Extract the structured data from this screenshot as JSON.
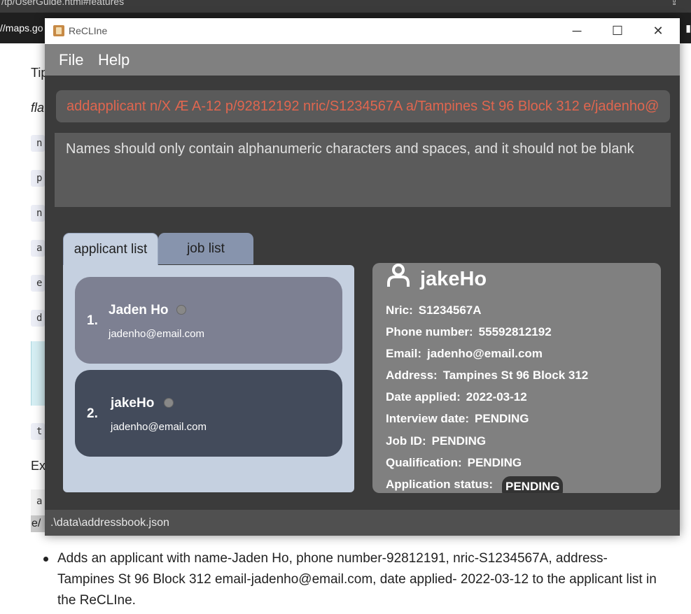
{
  "background": {
    "url_top": "/tp/UserGuide.html#features",
    "url_tab": "//maps.go",
    "lines": [
      "Tip",
      "fla",
      "Ex"
    ],
    "code_letters": [
      "n",
      "p",
      "n",
      "a",
      "e",
      "d",
      "t",
      "a"
    ],
    "selected_fragment": "e/",
    "bullet": "Adds an applicant with name-Jaden Ho, phone number-92812191, nric-S1234567A, address-Tampines St 96 Block 312 email-jadenho@email.com, date applied- 2022-03-12 to the applicant list in the ReCLIne."
  },
  "window": {
    "title": "ReCLIne",
    "menu": [
      "File",
      "Help"
    ],
    "command_text": "addapplicant n/X Æ A-12 p/92812192 nric/S1234567A a/Tampines St 96 Block 312 e/jadenho@",
    "result_text": "Names should only contain alphanumeric characters and spaces, and it should not be blank",
    "tabs": [
      "applicant list",
      "job list"
    ],
    "applicants": [
      {
        "index": "1.",
        "name": "Jaden Ho",
        "email": "jadenho@email.com"
      },
      {
        "index": "2.",
        "name": "jakeHo",
        "email": "jadenho@email.com"
      }
    ],
    "detail": {
      "name": "jakeHo",
      "rows": [
        {
          "label": "Nric:",
          "value": "S1234567A"
        },
        {
          "label": "Phone number:",
          "value": "55592812192"
        },
        {
          "label": "Email:",
          "value": "jadenho@email.com"
        },
        {
          "label": "Address:",
          "value": "Tampines St 96 Block 312"
        },
        {
          "label": "Date applied:",
          "value": "2022-03-12"
        },
        {
          "label": "Interview date:",
          "value": "PENDING"
        },
        {
          "label": "Job ID:",
          "value": "PENDING"
        },
        {
          "label": "Qualification:",
          "value": "PENDING"
        }
      ],
      "status_label": "Application status:",
      "status_value": "PENDING"
    },
    "status_path": ".\\data\\addressbook.json"
  },
  "colors": {
    "command_error": "#e0664f",
    "card_selected": "#7d8092",
    "card_normal": "#434b5b",
    "list_bg": "#c5d0e0"
  }
}
